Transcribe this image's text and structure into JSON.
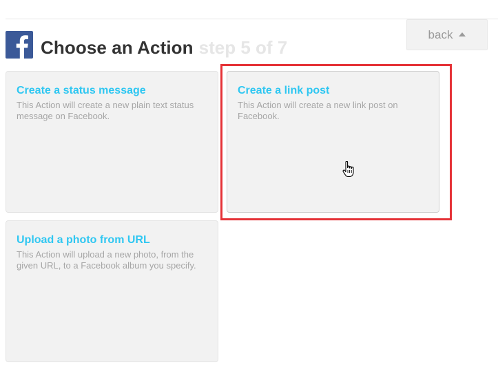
{
  "back_button": {
    "label": "back",
    "icon": "caret-up-icon"
  },
  "header": {
    "logo_icon": "facebook-logo-icon",
    "title": "Choose an Action",
    "step": "step 5 of 7"
  },
  "actions": [
    {
      "title": "Create a status message",
      "description": "This Action will create a new plain text status message on Facebook."
    },
    {
      "title": "Create a link post",
      "description": "This Action will create a new link post on Facebook."
    },
    {
      "title": "Upload a photo from URL",
      "description": "This Action will upload a new photo, from the given URL, to a Facebook album you specify."
    }
  ],
  "colors": {
    "action_title": "#2fc7f2",
    "highlight": "#e53237",
    "facebook_brand": "#3b5998"
  }
}
